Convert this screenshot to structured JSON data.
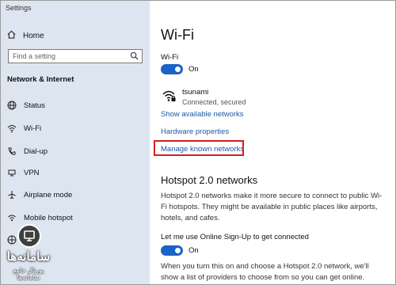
{
  "window": {
    "title": "Settings"
  },
  "sidebar": {
    "home": "Home",
    "search_placeholder": "Find a setting",
    "section": "Network & Internet",
    "items": [
      {
        "label": "Status",
        "icon": "globe-icon"
      },
      {
        "label": "Wi-Fi",
        "icon": "wifi-icon"
      },
      {
        "label": "Dial-up",
        "icon": "phone-icon"
      },
      {
        "label": "VPN",
        "icon": "vpn-icon"
      },
      {
        "label": "Airplane mode",
        "icon": "airplane-icon"
      },
      {
        "label": "Mobile hotspot",
        "icon": "hotspot-icon"
      },
      {
        "label": "",
        "icon": "globe-icon"
      }
    ]
  },
  "main": {
    "title": "Wi-Fi",
    "wifi_label": "Wi-Fi",
    "wifi_toggle_state": "On",
    "network": {
      "name": "tsunami",
      "status": "Connected, secured"
    },
    "show_networks": "Show available networks",
    "hardware_properties": "Hardware properties",
    "manage_known": "Manage known networks",
    "hotspot_title": "Hotspot 2.0 networks",
    "hotspot_desc": "Hotspot 2.0 networks make it more secure to connect to public Wi-Fi hotspots. They might be available in public places like airports, hotels, and cafes.",
    "online_signup_label": "Let me use Online Sign-Up to get connected",
    "online_signup_state": "On",
    "footer_desc": "When you turn this on and choose a Hotspot 2.0 network, we'll show a list of providers to choose from so you can get online."
  },
  "watermark": {
    "line1": "سامانه‌ها",
    "line2": "پورتال جامع سامانه‌ها"
  },
  "colors": {
    "accent": "#1a63c7",
    "highlight": "#d32020",
    "sidebar_bg": "#dde6f0",
    "link": "#1a5aa8"
  }
}
